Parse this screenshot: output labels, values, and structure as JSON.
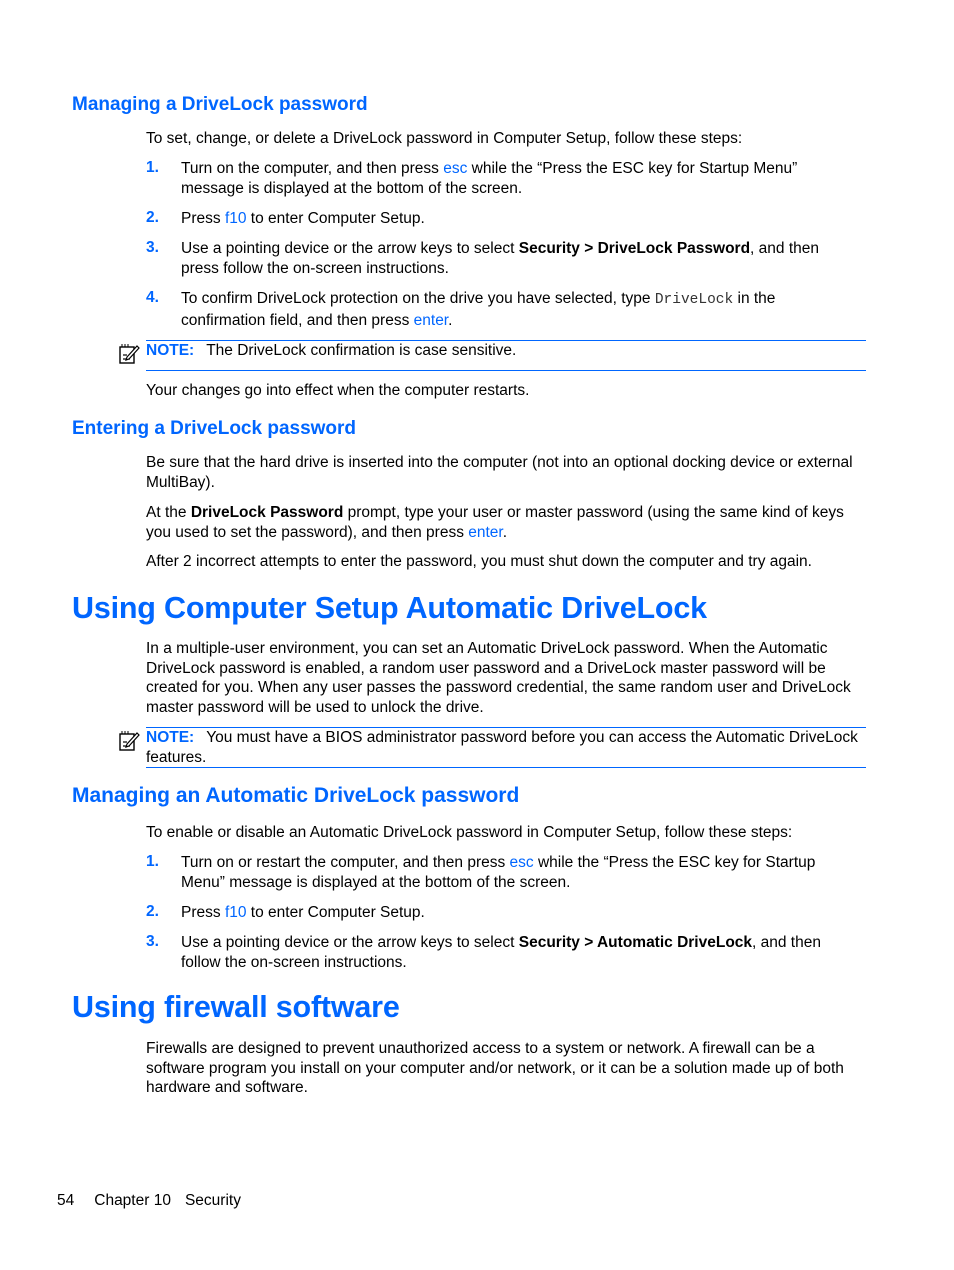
{
  "sections": {
    "managing": {
      "heading": "Managing a DriveLock password",
      "intro": "To set, change, or delete a DriveLock password in Computer Setup, follow these steps:",
      "steps": [
        {
          "num": "1.",
          "pre": "Turn on the computer, and then press ",
          "key": "esc",
          "post": " while the “Press the ESC key for Startup Menu” message is displayed at the bottom of the screen."
        },
        {
          "num": "2.",
          "pre": "Press ",
          "key": "f10",
          "post": " to enter Computer Setup."
        },
        {
          "num": "3.",
          "pre": "Use a pointing device or the arrow keys to select ",
          "bold": "Security > DriveLock Password",
          "post": ", and then press follow the on-screen instructions."
        },
        {
          "num": "4.",
          "pre": "To confirm DriveLock protection on the drive you have selected, type ",
          "code": "DriveLock",
          "mid": " in the confirmation field, and then press ",
          "key": "enter",
          "post": "."
        }
      ],
      "note_label": "NOTE:",
      "note_text": "The DriveLock confirmation is case sensitive.",
      "after": "Your changes go into effect when the computer restarts."
    },
    "entering": {
      "heading": "Entering a DriveLock password",
      "p1": "Be sure that the hard drive is inserted into the computer (not into an optional docking device or external MultiBay).",
      "p2_pre": "At the ",
      "p2_bold": "DriveLock Password",
      "p2_mid": " prompt, type your user or master password (using the same kind of keys you used to set the password), and then press ",
      "p2_key": "enter",
      "p2_post": ".",
      "p3": "After 2 incorrect attempts to enter the password, you must shut down the computer and try again."
    },
    "auto": {
      "heading": "Using Computer Setup Automatic DriveLock",
      "p1": "In a multiple-user environment, you can set an Automatic DriveLock password. When the Automatic DriveLock password is enabled, a random user password and a DriveLock master password will be created for you. When any user passes the password credential, the same random user and DriveLock master password will be used to unlock the drive.",
      "note_label": "NOTE:",
      "note_text": "You must have a BIOS administrator password before you can access the Automatic DriveLock features."
    },
    "managing_auto": {
      "heading": "Managing an Automatic DriveLock password",
      "intro": "To enable or disable an Automatic DriveLock password in Computer Setup, follow these steps:",
      "steps": [
        {
          "num": "1.",
          "pre": "Turn on or restart the computer, and then press ",
          "key": "esc",
          "post": " while the “Press the ESC key for Startup Menu” message is displayed at the bottom of the screen."
        },
        {
          "num": "2.",
          "pre": "Press ",
          "key": "f10",
          "post": " to enter Computer Setup."
        },
        {
          "num": "3.",
          "pre": "Use a pointing device or the arrow keys to select ",
          "bold": "Security > Automatic DriveLock",
          "post": ", and then follow the on-screen instructions."
        }
      ]
    },
    "firewall": {
      "heading": "Using firewall software",
      "p1": "Firewalls are designed to prevent unauthorized access to a system or network. A firewall can be a software program you install on your computer and/or network, or it can be a solution made up of both hardware and software."
    }
  },
  "footer": {
    "page": "54",
    "chapter": "Chapter 10",
    "title": "Security"
  },
  "colors": {
    "accent": "#0066ff",
    "text": "#000000"
  }
}
